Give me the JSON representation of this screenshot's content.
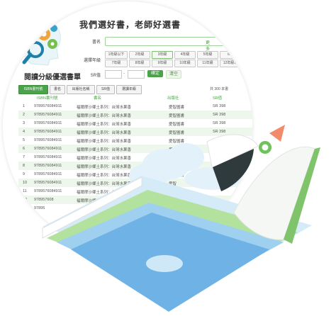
{
  "brand": {
    "title": "閱讀分級優選書單"
  },
  "slogan": "我們選好書，老師好選書",
  "search": {
    "label": "書名",
    "more": "更多"
  },
  "grade_filter": {
    "label": "選擇年級",
    "grades": [
      "1年級以下",
      "2年級",
      "3年級",
      "4年級",
      "5年級",
      "6年",
      "7年級",
      "8年級",
      "9年級",
      "10年級",
      "11年級",
      "12年級以"
    ],
    "selected": "3年級"
  },
  "sr_filter": {
    "label": "SR值",
    "confirm": "確定",
    "clear": "清空"
  },
  "sort": {
    "buttons": [
      "ISBN書刊號",
      "書名",
      "出版社名稱",
      "SR值",
      "選讀年級"
    ],
    "active": "ISBN書刊號",
    "count_text": "共 300 本書"
  },
  "table": {
    "headers": [
      "ISBN書刊號",
      "書名",
      "出版社",
      "SR值"
    ],
    "rows": [
      {
        "n": "1",
        "isbn": "9789576084911",
        "title": "福爾摩沙鄉土系列：台灣水果香",
        "pub": "愛智圖書",
        "sr": "SR 398"
      },
      {
        "n": "2",
        "isbn": "9789576084911",
        "title": "福爾摩沙鄉土系列：台灣水果香",
        "pub": "愛智圖書",
        "sr": "SR 398"
      },
      {
        "n": "3",
        "isbn": "9789576084911",
        "title": "福爾摩沙鄉土系列：台灣水果香",
        "pub": "愛智圖書",
        "sr": "SR 398"
      },
      {
        "n": "4",
        "isbn": "9789576084911",
        "title": "福爾摩沙鄉土系列：台灣水果香",
        "pub": "愛智圖書",
        "sr": "SR 398"
      },
      {
        "n": "5",
        "isbn": "9789576084911",
        "title": "福爾摩沙鄉土系列：台灣水果香",
        "pub": "愛智圖書",
        "sr": "SR 398"
      },
      {
        "n": "6",
        "isbn": "9789576084911",
        "title": "福爾摩沙鄉土系列：台灣水果香",
        "pub": "愛智圖書",
        "sr": "SR"
      },
      {
        "n": "7",
        "isbn": "9789576084911",
        "title": "福爾摩沙鄉土系列：台灣水果香",
        "pub": "愛智圖書",
        "sr": "S"
      },
      {
        "n": "8",
        "isbn": "9789576084911",
        "title": "福爾摩沙鄉土系列：台灣水果香",
        "pub": "愛智圖書",
        "sr": ""
      },
      {
        "n": "9",
        "isbn": "9789576084911",
        "title": "福爾摩沙鄉土系列：台灣水果香",
        "pub": "愛智圖書",
        "sr": ""
      },
      {
        "n": "10",
        "isbn": "9789576084911",
        "title": "福爾摩沙鄉土系列：台灣水果香",
        "pub": "愛智",
        "sr": ""
      },
      {
        "n": "11",
        "isbn": "9789576084911",
        "title": "福爾摩沙鄉土系列：台灣水果香",
        "pub": "愛",
        "sr": ""
      },
      {
        "n": "12",
        "isbn": "978957608",
        "title": "福爾摩沙鄉土",
        "pub": "",
        "sr": ""
      },
      {
        "n": "13",
        "isbn": "97895",
        "title": "",
        "pub": "",
        "sr": ""
      }
    ]
  },
  "colors": {
    "accent": "#4aa24a",
    "row_tint": "#eef7ec",
    "sky": "#cfe6f7",
    "book_green": "#8fd07a",
    "bird_coral": "#f28b6b"
  }
}
